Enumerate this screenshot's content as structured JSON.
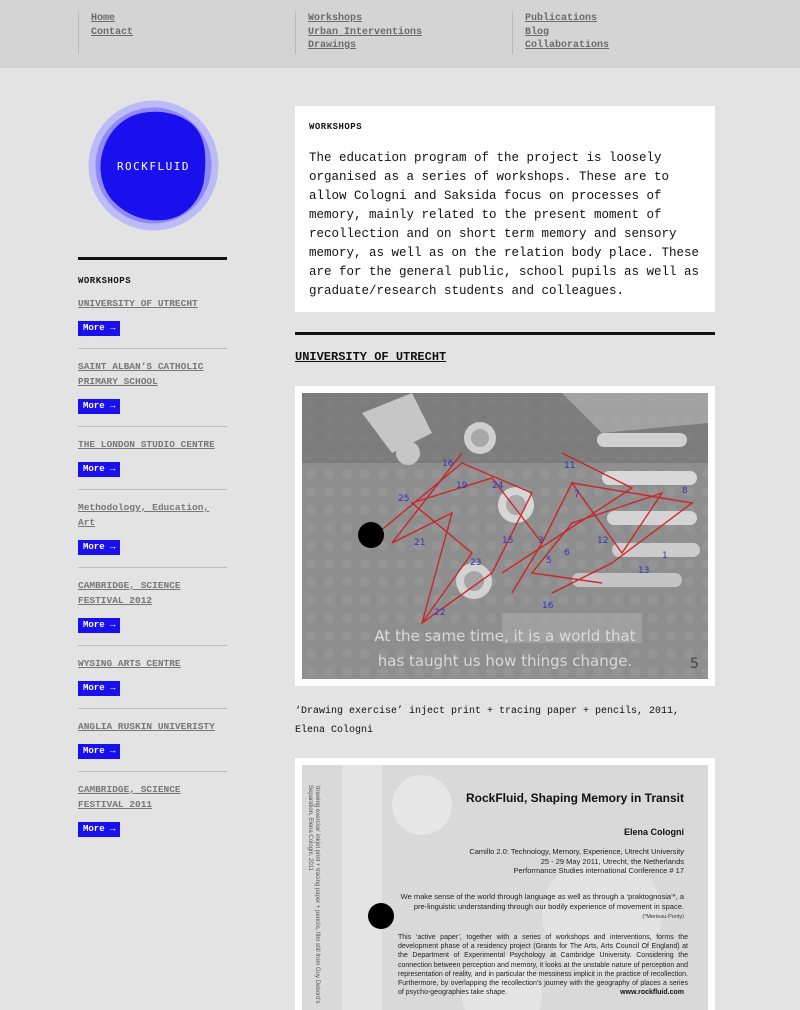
{
  "nav": {
    "col1": [
      "Home",
      "Contact"
    ],
    "col2": [
      "Workshops",
      "Urban Interventions",
      "Drawings"
    ],
    "col3": [
      "Publications",
      "Blog",
      "Collaborations"
    ]
  },
  "logo": {
    "text": "ROCKFLUID",
    "color": "#1a10ee"
  },
  "sidebar": {
    "heading": "WORKSHOPS",
    "more_label": "More →",
    "items": [
      {
        "title": "UNIVERSITY OF UTRECHT"
      },
      {
        "title": "SAINT ALBAN’S CATHOLIC PRIMARY SCHOOL"
      },
      {
        "title": "THE LONDON STUDIO CENTRE"
      },
      {
        "title": "Methodology, Education, Art"
      },
      {
        "title": "CAMBRIDGE, SCIENCE FESTIVAL 2012"
      },
      {
        "title": "WYSING ARTS CENTRE"
      },
      {
        "title": "ANGLIA RUSKIN UNIVERISTY"
      },
      {
        "title": "CAMBRIDGE, SCIENCE FESTIVAL 2011"
      }
    ]
  },
  "intro": {
    "heading": "WORKSHOPS",
    "body": "The education program of the project is loosely organised as a series of workshops. These are to allow Cologni and Saksida focus on processes of memory, mainly related to the present moment of recollection and on short term memory and sensory memory, as well as on the relation body place. These are for the general public, school pupils as well as graduate/research students and colleagues."
  },
  "section": {
    "title": "UNIVERSITY OF UTRECHT",
    "image1_overlay": "At the same time, it is a world that has taught us how things change.",
    "caption": "‘Drawing exercise’ inject print + tracing paper + pencils, 2011, Elena Cologni"
  },
  "doc": {
    "side_text": "'drawing exercise' inkjet print + tracing paper + pencils, film still from Guy Debord's Separation, Elena Cologni, 2011",
    "title": "RockFluid, Shaping Memory in Transit",
    "author": "Elena Cologni",
    "conf_line1": "Camillo 2.0: Technology, Memory, Experience, Utrecht University",
    "conf_line2": "25 - 29 May 2011, Utrecht, the Netherlands",
    "conf_line3": "Performance Studies international Conference # 17",
    "quote": "We make sense of the world through language as well as through a ‘praktognosia’*, a pre-linguistic understanding through our bodily experience of movement in space.",
    "quote_attr": "(*Merleau-Ponty)",
    "body": "This ‘active paper’, together with a series of workshops and interventions, forms the development phase of a residency project (Grants for The Arts, Arts Council Of England) at the Department of Experimental Psychology at Cambridge University. Considering the connection between perception and memory, it looks at the unstable nature of perception and representation of reality, and in particular the messiness implicit in the practice of recollection. Furthermore, by overlapping the recollection’s journey with the geography of places a series of psycho-geographies take shape.",
    "site": "www.rockfluid.com"
  }
}
